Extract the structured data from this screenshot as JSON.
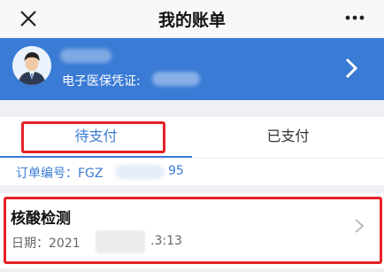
{
  "header": {
    "title": "我的账单",
    "close_icon": "close-icon",
    "more_icon": "more-horizontal-icon"
  },
  "profile": {
    "voucher_label": "电子医保凭证:",
    "avatar_icon": "user-avatar-icon",
    "arrow_icon": "chevron-right-icon"
  },
  "tabs": [
    {
      "label": "待支付",
      "active": true
    },
    {
      "label": "已支付",
      "active": false
    }
  ],
  "order": {
    "label": "订单编号：FGZ",
    "suffix": "95"
  },
  "bill_item": {
    "name": "核酸检测",
    "date_label": "日期：2021",
    "date_suffix": ".3:13"
  },
  "colors": {
    "accent": "#3a7bd5",
    "highlight": "#e52127",
    "background": "#efeff4"
  }
}
